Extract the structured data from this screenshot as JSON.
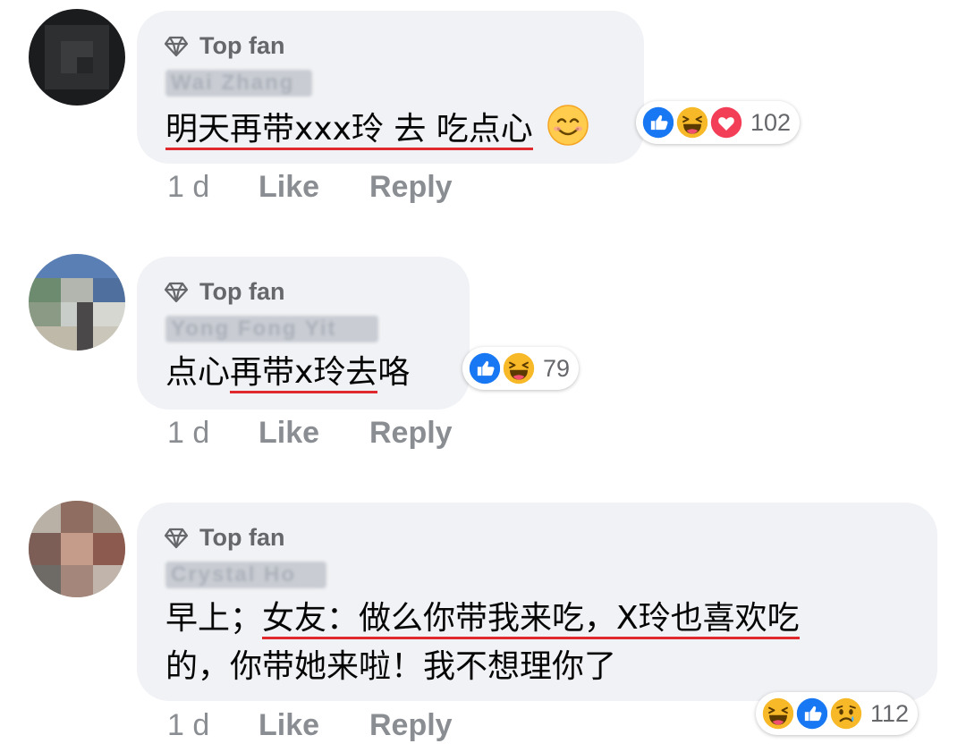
{
  "comments": [
    {
      "badge": "Top fan",
      "author": "Wai Zhang",
      "text_parts": [
        "明天再带xxx玲 去 吃点心",
        ""
      ],
      "emoji": "smiling-face",
      "time": "1 d",
      "like_label": "Like",
      "reply_label": "Reply",
      "reaction_count": "102",
      "reactions": [
        "like-icon",
        "haha-icon",
        "love-icon"
      ]
    },
    {
      "badge": "Top fan",
      "author": "Yong Fong Yit",
      "text_pre": "点心",
      "text_underlined": "再带x玲去",
      "text_post": "咯",
      "time": "1 d",
      "like_label": "Like",
      "reply_label": "Reply",
      "reaction_count": "79",
      "reactions": [
        "like-icon",
        "haha-icon"
      ]
    },
    {
      "badge": "Top fan",
      "author": "Crystal Ho",
      "line1_pre": "早上；",
      "line1_underlined": "女友：做么你带我来吃，X玲也喜欢吃",
      "line2": "的，你带她来啦！我不想理你了",
      "time": "1 d",
      "like_label": "Like",
      "reply_label": "Reply",
      "reaction_count": "112",
      "reactions": [
        "haha-icon",
        "like-icon",
        "sad-icon"
      ]
    }
  ],
  "colors": {
    "bubble": "#f0f2f5",
    "underline": "#e0292e",
    "like_blue": "#1877f2",
    "love_red": "#f33e58",
    "haha_yellow": "#f7b928"
  }
}
